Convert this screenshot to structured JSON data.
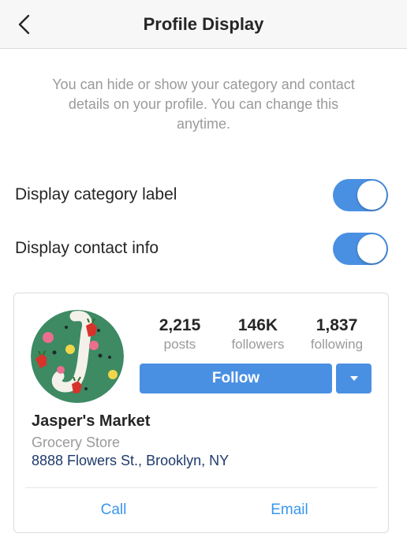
{
  "header": {
    "title": "Profile Display",
    "back_icon": "chevron-left-icon"
  },
  "intro": {
    "text": "You can hide or show your category and contact details on your profile. You can change this anytime."
  },
  "toggles": [
    {
      "label": "Display category label",
      "on": true
    },
    {
      "label": "Display contact info",
      "on": true
    }
  ],
  "preview": {
    "stats": [
      {
        "value": "2,215",
        "caption": "posts"
      },
      {
        "value": "146K",
        "caption": "followers"
      },
      {
        "value": "1,837",
        "caption": "following"
      }
    ],
    "follow_label": "Follow",
    "dropdown_icon": "caret-down-icon",
    "name": "Jasper's Market",
    "category": "Grocery Store",
    "address": "8888 Flowers St., Brooklyn, NY",
    "actions": [
      "Call",
      "Email"
    ]
  },
  "colors": {
    "accent": "#4a90e2",
    "link": "#3897f0",
    "address": "#1f3a6b",
    "muted": "#9a9a9a",
    "avatar_bg": "#3d8a63"
  }
}
